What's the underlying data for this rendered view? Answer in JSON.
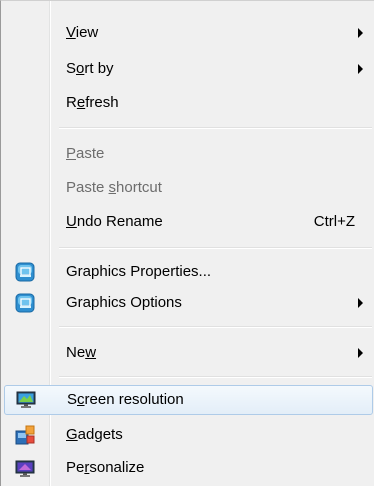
{
  "menu": {
    "view": {
      "pre": "",
      "u": "V",
      "post": "iew"
    },
    "sort_by": {
      "pre": "S",
      "u": "o",
      "post": "rt by"
    },
    "refresh": {
      "pre": "R",
      "u": "e",
      "post": "fresh"
    },
    "paste": {
      "pre": "",
      "u": "P",
      "post": "aste"
    },
    "paste_shortcut": {
      "pre": "Paste ",
      "u": "s",
      "post": "hortcut"
    },
    "undo_rename": {
      "pre": "",
      "u": "U",
      "post": "ndo Rename",
      "shortcut": "Ctrl+Z"
    },
    "graphics_properties": {
      "label": "Graphics Properties..."
    },
    "graphics_options": {
      "label": "Graphics Options"
    },
    "new": {
      "pre": "Ne",
      "u": "w",
      "post": ""
    },
    "screen_resolution": {
      "pre": "S",
      "u": "c",
      "post": "reen resolution"
    },
    "gadgets": {
      "pre": "",
      "u": "G",
      "post": "adgets"
    },
    "personalize": {
      "pre": "Pe",
      "u": "r",
      "post": "sonalize"
    }
  },
  "colors": {
    "menu_bg": "#f0f0f0",
    "disabled_text": "#6d6d6d",
    "highlight_border": "#aecbe8"
  }
}
